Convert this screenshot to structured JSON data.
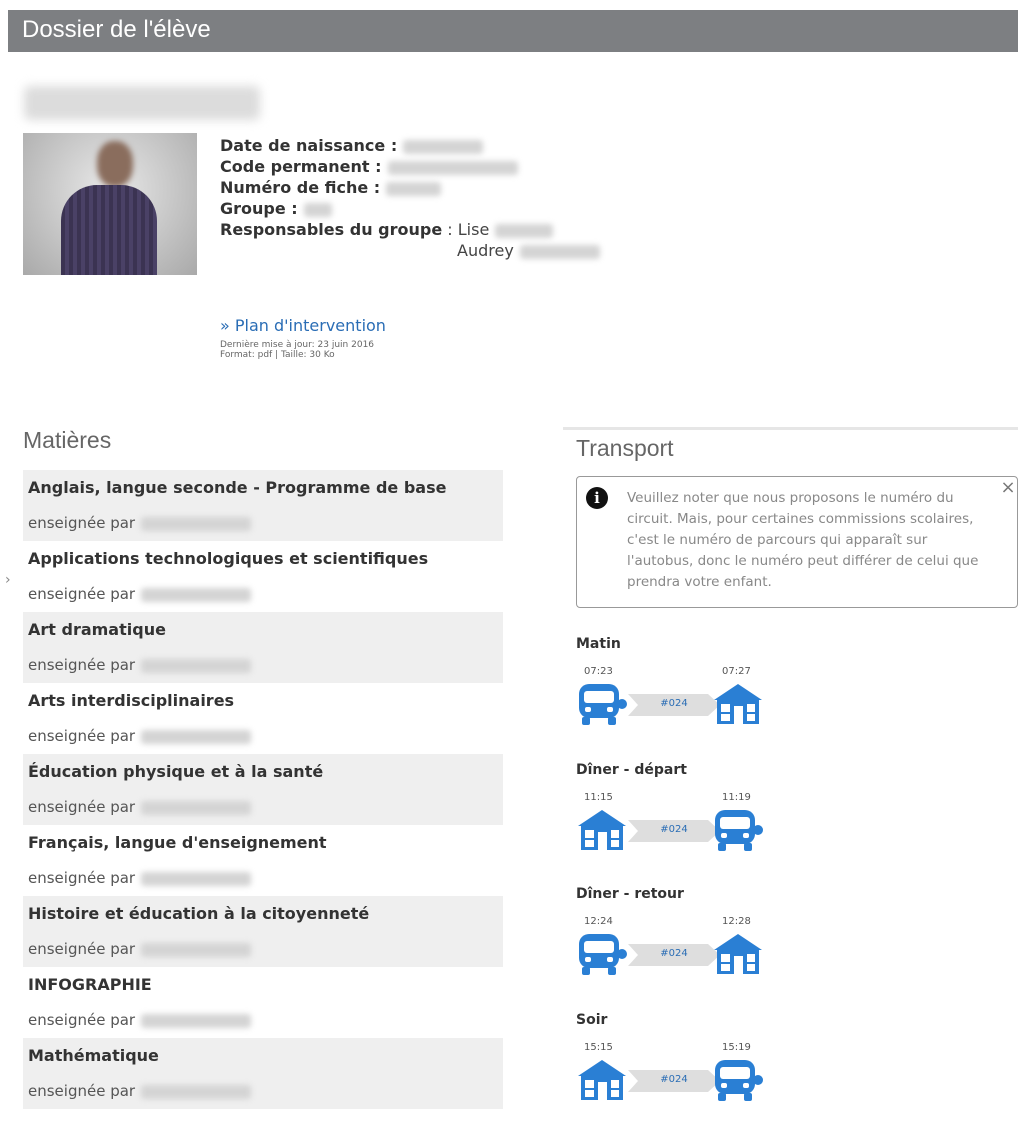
{
  "header": {
    "title": "Dossier de l'élève"
  },
  "student": {
    "fields": [
      {
        "label": "Date de naissance :"
      },
      {
        "label": "Code permanent :"
      },
      {
        "label": "Numéro de fiche :"
      },
      {
        "label": "Groupe :"
      }
    ],
    "responsables": {
      "label": "Responsables du groupe",
      "separator": ":",
      "names": [
        "Lise",
        "Audrey"
      ]
    }
  },
  "plan": {
    "link_text": "» Plan d'intervention",
    "updated": "Dernière mise à jour: 23 juin 2016",
    "format": "Format: pdf | Taille: 30 Ko"
  },
  "subjects_section": {
    "title": "Matières",
    "teacher_prefix": "enseignée par",
    "items": [
      {
        "name": "Anglais, langue seconde - Programme de base"
      },
      {
        "name": "Applications technologiques et scientifiques"
      },
      {
        "name": "Art dramatique"
      },
      {
        "name": "Arts interdisciplinaires"
      },
      {
        "name": "Éducation physique et à la santé"
      },
      {
        "name": "Français, langue d'enseignement"
      },
      {
        "name": "Histoire et éducation à la citoyenneté"
      },
      {
        "name": "INFOGRAPHIE"
      },
      {
        "name": "Mathématique"
      }
    ]
  },
  "transport": {
    "title": "Transport",
    "notice": "Veuillez noter que nous proposons le numéro du circuit. Mais, pour certaines commissions scolaires, c'est le numéro de parcours qui apparaît sur l'autobus, donc le numéro peut différer de celui que prendra votre enfant.",
    "close_symbol": "×",
    "info_symbol": "i",
    "accent_color": "#2a7fd4",
    "trips": [
      {
        "label": "Matin",
        "time_start": "07:23",
        "time_end": "07:27",
        "route": "#024",
        "from_icon": "bus-icon",
        "to_icon": "school-icon"
      },
      {
        "label": "Dîner - départ",
        "time_start": "11:15",
        "time_end": "11:19",
        "route": "#024",
        "from_icon": "school-icon",
        "to_icon": "bus-icon"
      },
      {
        "label": "Dîner - retour",
        "time_start": "12:24",
        "time_end": "12:28",
        "route": "#024",
        "from_icon": "bus-icon",
        "to_icon": "school-icon"
      },
      {
        "label": "Soir",
        "time_start": "15:15",
        "time_end": "15:19",
        "route": "#024",
        "from_icon": "school-icon",
        "to_icon": "bus-icon"
      }
    ]
  }
}
